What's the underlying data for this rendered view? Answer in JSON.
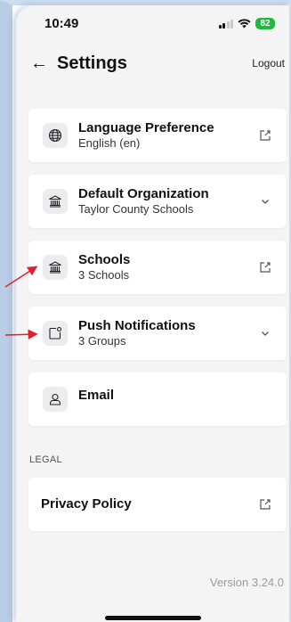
{
  "status_bar": {
    "time": "10:49",
    "battery": "82"
  },
  "header": {
    "back_icon": "arrow-left-icon",
    "title": "Settings",
    "logout_label": "Logout"
  },
  "settings": [
    {
      "title": "Language Preference",
      "subtitle": "English (en)",
      "icon": "globe-icon",
      "action_icon": "external-link-icon"
    },
    {
      "title": "Default Organization",
      "subtitle": "Taylor County Schools",
      "icon": "building-icon",
      "action_icon": "chevron-down-icon"
    },
    {
      "title": "Schools",
      "subtitle": "3 Schools",
      "icon": "building-icon",
      "action_icon": "external-link-icon"
    },
    {
      "title": "Push Notifications",
      "subtitle": "3 Groups",
      "icon": "notification-icon",
      "action_icon": "chevron-down-icon"
    },
    {
      "title": "Email",
      "subtitle": "",
      "icon": "user-icon"
    }
  ],
  "legal": {
    "section_label": "LEGAL",
    "privacy_policy": {
      "title": "Privacy Policy",
      "action_icon": "external-link-icon"
    }
  },
  "footer": {
    "version": "Version 3.24.0"
  },
  "annotation_color": "#e0202a"
}
